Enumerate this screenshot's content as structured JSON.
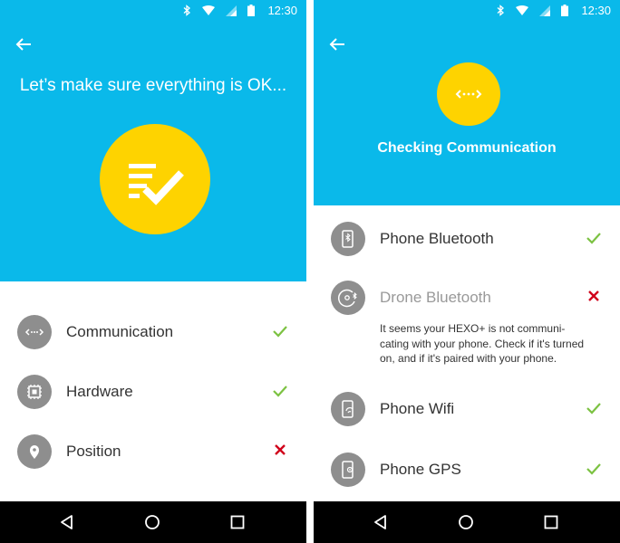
{
  "status": {
    "time": "12:30"
  },
  "left": {
    "title": "Let’s make sure everything is OK...",
    "items": [
      {
        "label": "Communication",
        "status": "ok"
      },
      {
        "label": "Hardware",
        "status": "ok"
      },
      {
        "label": "Position",
        "status": "error"
      }
    ]
  },
  "right": {
    "title": "Checking Communication",
    "items": [
      {
        "label": "Phone Bluetooth",
        "status": "ok"
      },
      {
        "label": "Drone Bluetooth",
        "status": "error"
      },
      {
        "label": "Phone Wifi",
        "status": "ok"
      },
      {
        "label": "Phone GPS",
        "status": "ok"
      }
    ],
    "error_message": "It seems your HEXO+ is not communi-cating with your phone. Check if it's turned on, and if it's paired with your phone."
  },
  "colors": {
    "header": "#0ab9ea",
    "accent": "#fed300",
    "ok": "#7cc242",
    "error": "#d0021b",
    "icon_bg": "#8e8e8e"
  },
  "icons": [
    "bluetooth-icon",
    "wifi-icon",
    "signal-icon",
    "battery-icon",
    "back-arrow-icon",
    "checklist-icon",
    "communication-icon",
    "chip-icon",
    "location-pin-icon",
    "phone-bluetooth-icon",
    "drone-bluetooth-icon",
    "phone-wifi-icon",
    "phone-gps-icon",
    "check-icon",
    "cross-icon",
    "nav-back-icon",
    "nav-home-icon",
    "nav-recents-icon"
  ]
}
